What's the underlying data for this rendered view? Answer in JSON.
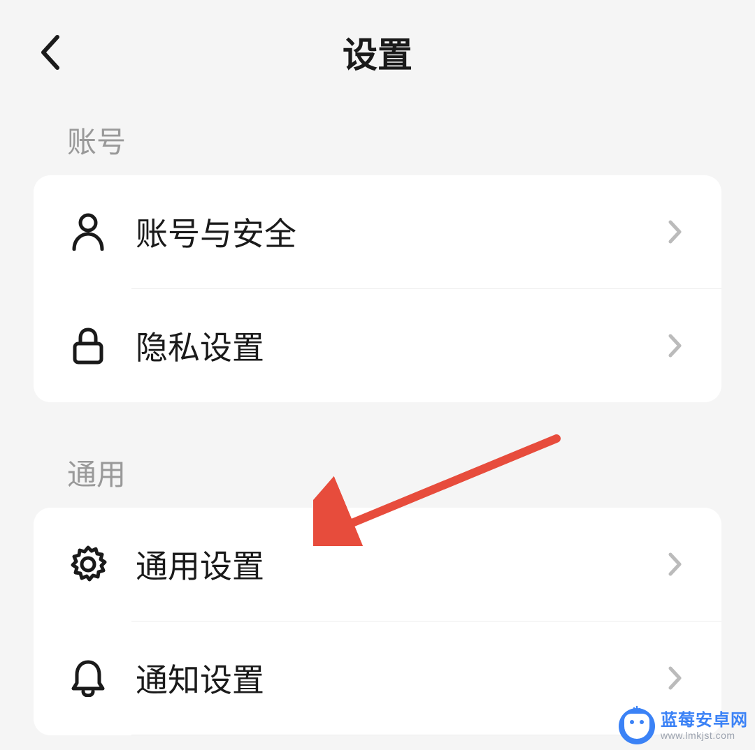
{
  "header": {
    "title": "设置"
  },
  "sections": {
    "account": {
      "header": "账号",
      "items": {
        "account_security": {
          "label": "账号与安全",
          "icon": "user-icon"
        },
        "privacy": {
          "label": "隐私设置",
          "icon": "lock-icon"
        }
      }
    },
    "general": {
      "header": "通用",
      "items": {
        "general_settings": {
          "label": "通用设置",
          "icon": "gear-icon"
        },
        "notifications": {
          "label": "通知设置",
          "icon": "bell-icon"
        }
      }
    }
  },
  "annotation": {
    "type": "arrow",
    "color": "#e74c3c",
    "target_item": "general_settings"
  },
  "watermark": {
    "name": "蓝莓安卓网",
    "url": "www.lmkjst.com"
  }
}
